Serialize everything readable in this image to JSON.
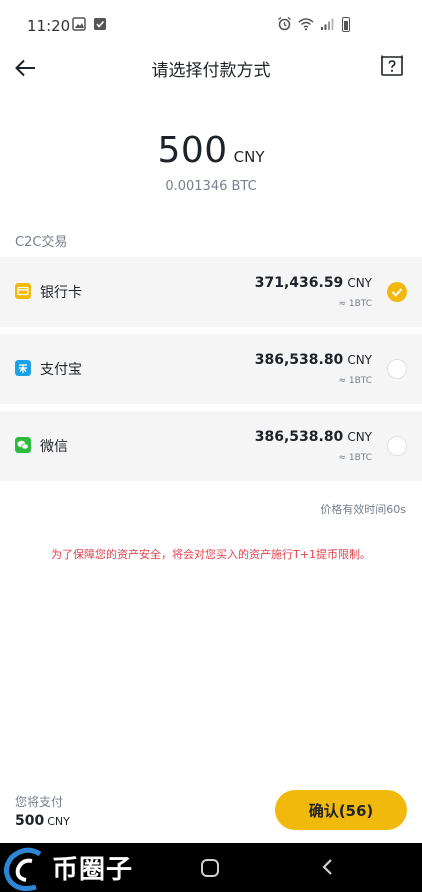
{
  "status_bar": {
    "time": "11:20"
  },
  "header": {
    "title": "请选择付款方式"
  },
  "amount": {
    "value": "500",
    "unit": "CNY",
    "btc": "0.001346 BTC"
  },
  "section": {
    "label": "C2C交易"
  },
  "payment_methods": [
    {
      "name": "银行卡",
      "price": "371,436.59",
      "unit": "CNY",
      "sub": "≈ 1BTC",
      "selected": true,
      "icon": "bank-card-icon",
      "icon_color": "#f0b90b"
    },
    {
      "name": "支付宝",
      "price": "386,538.80",
      "unit": "CNY",
      "sub": "≈ 1BTC",
      "selected": false,
      "icon": "alipay-icon",
      "icon_color": "#1aa1e6"
    },
    {
      "name": "微信",
      "price": "386,538.80",
      "unit": "CNY",
      "sub": "≈ 1BTC",
      "selected": false,
      "icon": "wechat-icon",
      "icon_color": "#2dbb3e"
    }
  ],
  "validity": "价格有效时间60s",
  "notice": "为了保障您的资产安全，将会对您买入的资产施行T+1提币限制。",
  "footer": {
    "pay_label": "您将支付",
    "pay_amount": "500",
    "pay_unit": "CNY",
    "confirm_label": "确认(56)"
  },
  "watermark": {
    "text": "币圈子"
  },
  "colors": {
    "accent": "#f0b90b",
    "notice": "#e0444f",
    "muted": "#76808f"
  }
}
